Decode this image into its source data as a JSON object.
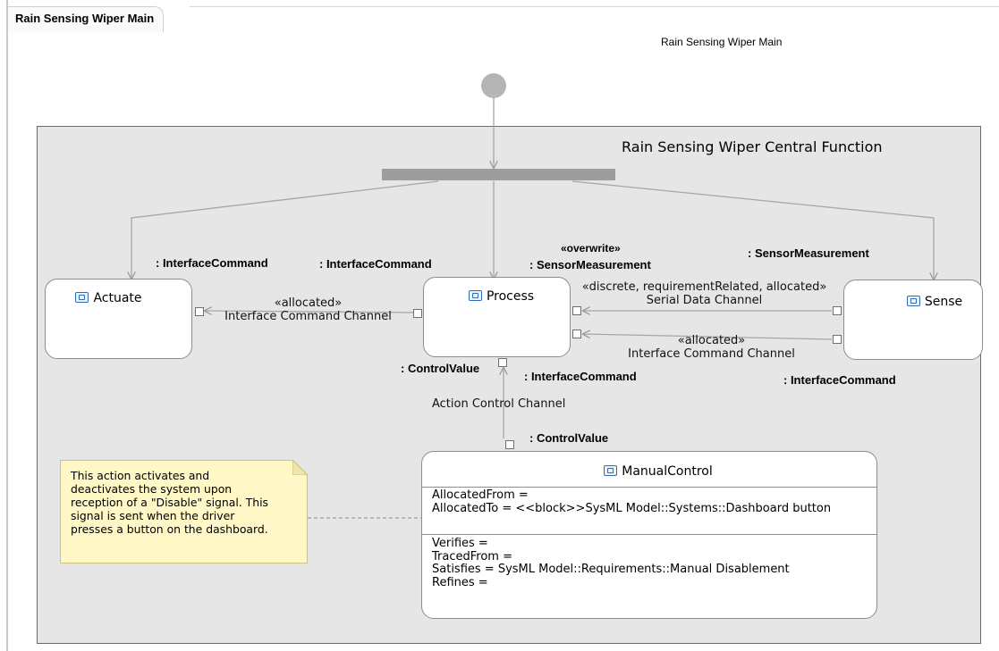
{
  "diagram": {
    "tab_title": "Rain Sensing Wiper Main",
    "caption": "Rain Sensing Wiper Main",
    "frame_title": "Rain Sensing Wiper Central Function"
  },
  "actions": {
    "actuate": "Actuate",
    "process": "Process",
    "sense": "Sense",
    "manual_control": "ManualControl"
  },
  "pin_labels": {
    "actuate_in": ": InterfaceCommand",
    "process_out_command": ": InterfaceCommand",
    "process_stereotype": "«overwrite»",
    "process_in_measurement": ": SensorMeasurement",
    "sense_out_measurement": ": SensorMeasurement",
    "process_control_value": ": ControlValue",
    "process_in_command": ": InterfaceCommand",
    "sense_in_command": ": InterfaceCommand",
    "manual_control_value": ": ControlValue"
  },
  "flows": {
    "to_actuate_stereotype": "«allocated»",
    "to_actuate_name": "Interface Command Channel",
    "serial_stereotype": "«discrete, requirementRelated, allocated»",
    "serial_name": "Serial Data Channel",
    "to_process_stereotype": "«allocated»",
    "to_process_name": "Interface Command Channel",
    "action_control": "Action Control Channel"
  },
  "manual_control_compartments": {
    "allocated_from": "AllocatedFrom =",
    "allocated_to": "AllocatedTo = <<block>>SysML Model::Systems::Dashboard button",
    "verifies": "Verifies =",
    "traced_from": "TracedFrom =",
    "satisfies": "Satisfies = SysML Model::Requirements::Manual Disablement",
    "refines": "Refines ="
  },
  "note": {
    "text": "This action activates and\ndeactivates the system upon\nreception of a \"Disable\" signal. This\nsignal is sent when the driver\npresses a button on the dashboard."
  },
  "colors": {
    "frame_background": "#e6e6e6",
    "note_background": "#fff7c5",
    "icon_blue": "#2f6dba"
  },
  "icons": {
    "action_icon": "call-behavior-action-icon"
  }
}
